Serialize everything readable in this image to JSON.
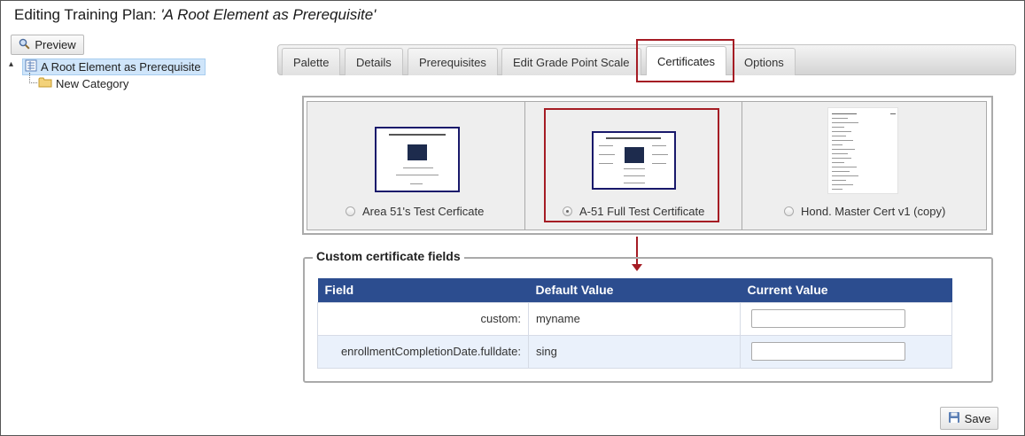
{
  "page": {
    "title_prefix": "Editing Training Plan: ",
    "title_name": "'A Root Element as Prerequisite'"
  },
  "toolbar": {
    "preview_label": "Preview",
    "preview_icon": "magnifier-icon"
  },
  "tree": {
    "root_label": "A Root Element as Prerequisite",
    "root_icon": "document-icon",
    "child_label": "New Category",
    "child_icon": "folder-icon"
  },
  "tabs": [
    {
      "label": "Palette",
      "active": false
    },
    {
      "label": "Details",
      "active": false
    },
    {
      "label": "Prerequisites",
      "active": false
    },
    {
      "label": "Edit Grade Point Scale",
      "active": false
    },
    {
      "label": "Certificates",
      "active": true
    },
    {
      "label": "Options",
      "active": false
    }
  ],
  "certificates": [
    {
      "label": "Area 51's Test Cerficate",
      "selected": false
    },
    {
      "label": "A-51 Full Test Certificate",
      "selected": true
    },
    {
      "label": "Hond. Master Cert v1 (copy)",
      "selected": false
    }
  ],
  "custom_fields": {
    "legend": "Custom certificate fields",
    "headers": {
      "field": "Field",
      "default": "Default Value",
      "current": "Current Value"
    },
    "rows": [
      {
        "field": "custom:",
        "default": "myname",
        "current": ""
      },
      {
        "field": "enrollmentCompletionDate.fulldate:",
        "default": "sing",
        "current": ""
      }
    ]
  },
  "footer": {
    "save_label": "Save",
    "save_icon": "floppy-disk-icon"
  },
  "colors": {
    "highlight": "#a51c24",
    "table_header": "#2c4d8f",
    "tree_selected": "#cfe5fa"
  }
}
